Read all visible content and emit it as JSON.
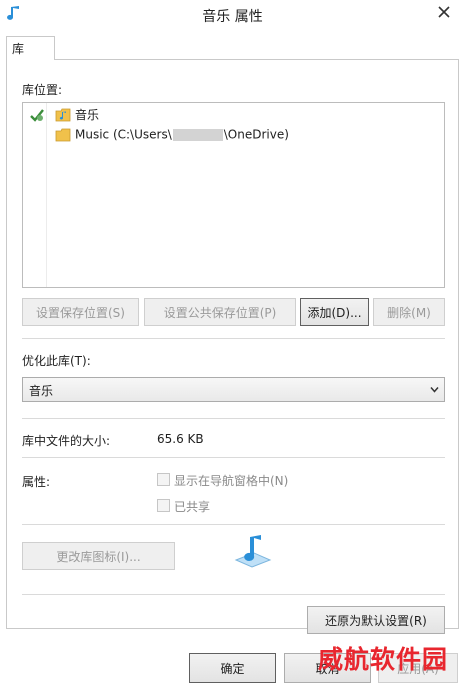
{
  "window": {
    "title": "音乐 属性"
  },
  "tabs": [
    {
      "label": "库"
    }
  ],
  "library_locations": {
    "label": "库位置:",
    "items": [
      {
        "name": "音乐"
      },
      {
        "prefix": "Music (C:\\Users\\",
        "suffix": "\\OneDrive)"
      }
    ]
  },
  "location_buttons": {
    "set_save": "设置保存位置(S)",
    "set_public_save": "设置公共保存位置(P)",
    "add": "添加(D)...",
    "remove": "删除(M)"
  },
  "optimize": {
    "label": "优化此库(T):",
    "selected": "音乐"
  },
  "size": {
    "label": "库中文件的大小:",
    "value": "65.6 KB"
  },
  "attributes": {
    "label": "属性:",
    "show_in_nav": "显示在导航窗格中(N)",
    "shared": "已共享"
  },
  "change_icon_button": "更改库图标(I)...",
  "restore_defaults_button": "还原为默认设置(R)",
  "footer": {
    "ok": "确定",
    "cancel": "取消",
    "apply": "应用(A)"
  },
  "watermark": "威航软件园",
  "colors": {
    "watermark": "#e8262e",
    "music_icon": "#2a8fd8"
  }
}
